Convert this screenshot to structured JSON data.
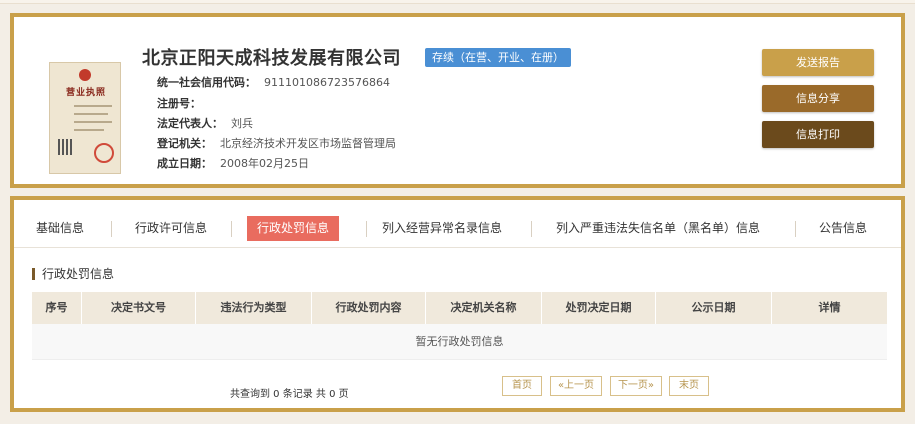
{
  "company": {
    "name": "北京正阳天成科技发展有限公司",
    "status": "存续（在营、开业、在册）",
    "license_title": "营业执照",
    "fields": [
      {
        "label": "统一社会信用代码：",
        "value": "911101086723576864"
      },
      {
        "label": "注册号：",
        "value": ""
      },
      {
        "label": "法定代表人：",
        "value": "刘兵"
      },
      {
        "label": "登记机关：",
        "value": "北京经济技术开发区市场监督管理局"
      },
      {
        "label": "成立日期：",
        "value": "2008年02月25日"
      }
    ]
  },
  "actions": {
    "send_report": "发送报告",
    "share_info": "信息分享",
    "print_info": "信息打印"
  },
  "tabs": [
    {
      "label": "基础信息"
    },
    {
      "label": "行政许可信息"
    },
    {
      "label": "行政处罚信息"
    },
    {
      "label": "列入经营异常名录信息"
    },
    {
      "label": "列入严重违法失信名单（黑名单）信息"
    },
    {
      "label": "公告信息"
    }
  ],
  "active_tab": "行政处罚信息",
  "section_title": "行政处罚信息",
  "table": {
    "columns": [
      "序号",
      "决定书文号",
      "违法行为类型",
      "行政处罚内容",
      "决定机关名称",
      "处罚决定日期",
      "公示日期",
      "详情"
    ],
    "empty_text": "暂无行政处罚信息"
  },
  "pager": {
    "summary": "共查询到 0 条记录 共 0 页",
    "first": "首页",
    "prev": "«上一页",
    "next": "下一页»",
    "last": "末页"
  },
  "colors": {
    "frame": "#c9a04a",
    "status_badge": "#4a8fd4",
    "active_tab": "#e96c5f",
    "btn_report": "#c9a04a",
    "btn_share": "#9a6a2a",
    "btn_print": "#6b4a1c"
  }
}
